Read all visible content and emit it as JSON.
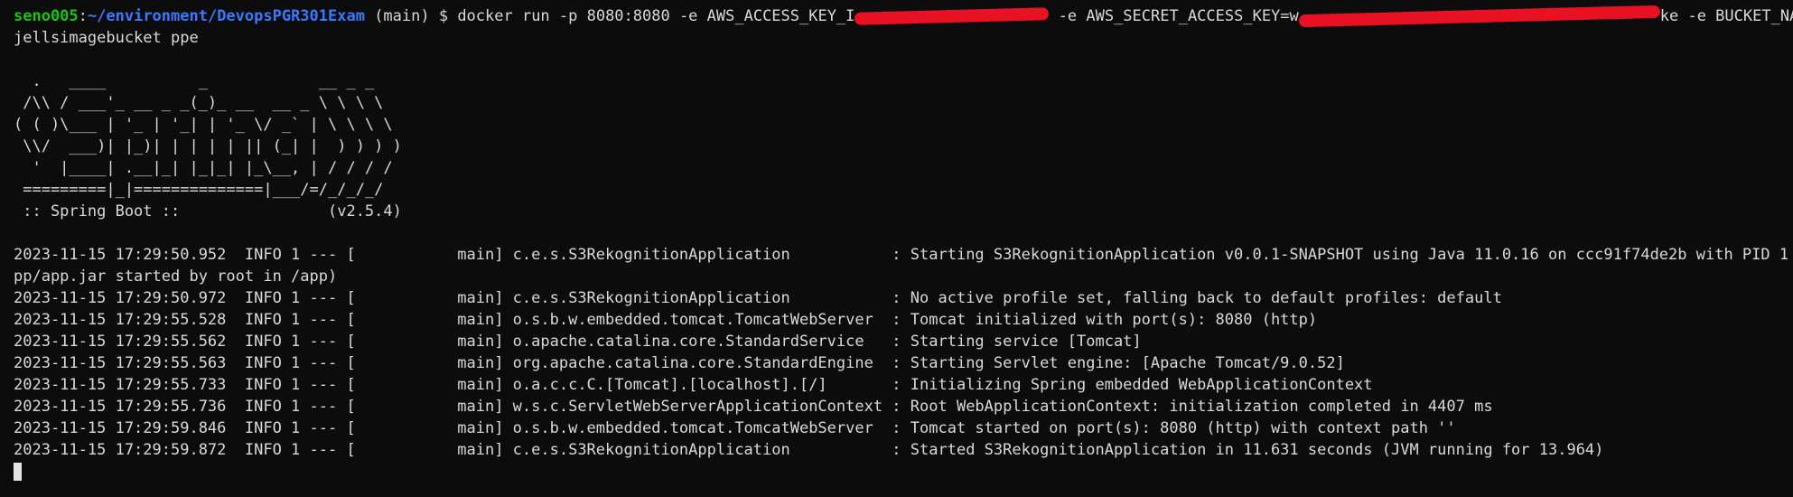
{
  "prompt": {
    "user_host": "seno005",
    "path": "~/environment/DevopsPGR301Exam",
    "branch": " (main) $ ",
    "command_part1": "docker run -p 8080:8080 -e AWS_ACCESS_KEY_I",
    "command_part2": " -e AWS_SECRET_ACCESS_KEY=w",
    "command_part3": "ke -e BUCKET_NAME=k",
    "command_wrap": "jellsimagebucket ppe"
  },
  "banner": [
    "  .   ____          _            __ _ _",
    " /\\\\ / ___'_ __ _ _(_)_ __  __ _ \\ \\ \\ \\",
    "( ( )\\___ | '_ | '_| | '_ \\/ _` | \\ \\ \\ \\",
    " \\\\/  ___)| |_)| | | | | || (_| |  ) ) ) )",
    "  '  |____| .__|_| |_|_| |_\\__, | / / / /",
    " =========|_|==============|___/=/_/_/_/",
    " :: Spring Boot ::                (v2.5.4)"
  ],
  "logs": [
    "2023-11-15 17:29:50.952  INFO 1 --- [           main] c.e.s.S3RekognitionApplication           : Starting S3RekognitionApplication v0.0.1-SNAPSHOT using Java 11.0.16 on ccc91f74de2b with PID 1 (/a",
    "pp/app.jar started by root in /app)",
    "2023-11-15 17:29:50.972  INFO 1 --- [           main] c.e.s.S3RekognitionApplication           : No active profile set, falling back to default profiles: default",
    "2023-11-15 17:29:55.528  INFO 1 --- [           main] o.s.b.w.embedded.tomcat.TomcatWebServer  : Tomcat initialized with port(s): 8080 (http)",
    "2023-11-15 17:29:55.562  INFO 1 --- [           main] o.apache.catalina.core.StandardService   : Starting service [Tomcat]",
    "2023-11-15 17:29:55.563  INFO 1 --- [           main] org.apache.catalina.core.StandardEngine  : Starting Servlet engine: [Apache Tomcat/9.0.52]",
    "2023-11-15 17:29:55.733  INFO 1 --- [           main] o.a.c.c.C.[Tomcat].[localhost].[/]       : Initializing Spring embedded WebApplicationContext",
    "2023-11-15 17:29:55.736  INFO 1 --- [           main] w.s.c.ServletWebServerApplicationContext : Root WebApplicationContext: initialization completed in 4407 ms",
    "2023-11-15 17:29:59.846  INFO 1 --- [           main] o.s.b.w.embedded.tomcat.TomcatWebServer  : Tomcat started on port(s): 8080 (http) with context path ''",
    "2023-11-15 17:29:59.872  INFO 1 --- [           main] c.e.s.S3RekognitionApplication           : Started S3RekognitionApplication in 11.631 seconds (JVM running for 13.964)"
  ],
  "colors": {
    "background": "#0c0c0c",
    "foreground": "#d9d9d9",
    "user_host": "#16c60c",
    "path": "#3b78ff",
    "redaction": "#e81123"
  }
}
